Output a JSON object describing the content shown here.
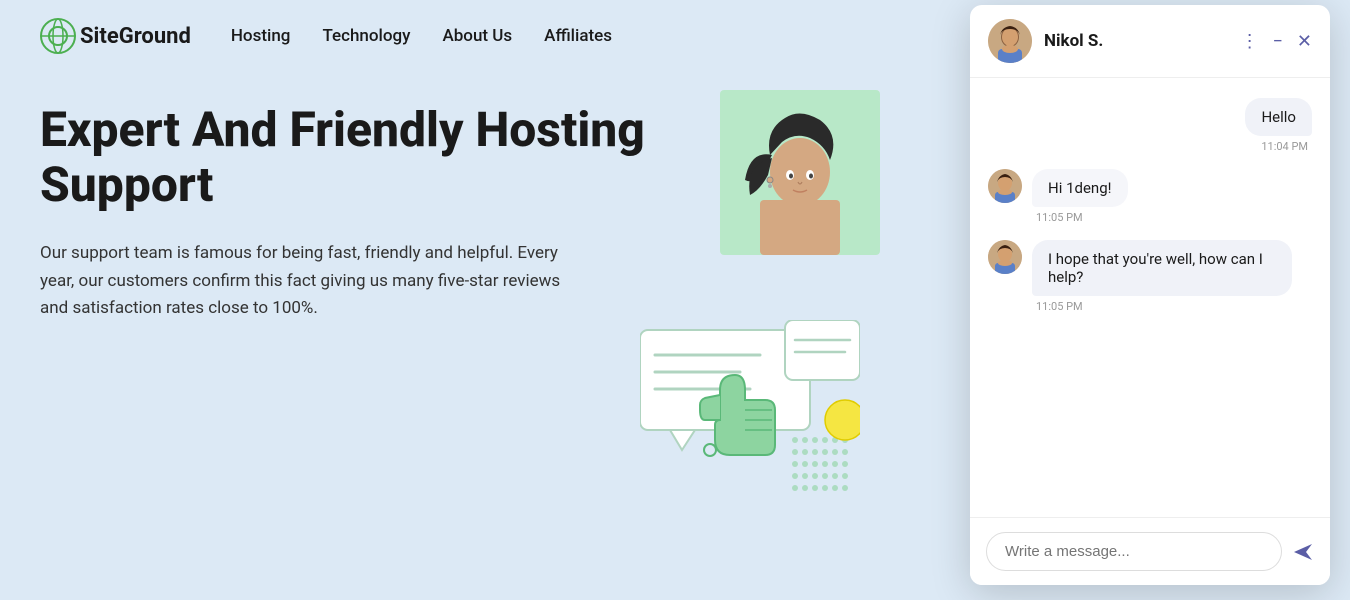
{
  "nav": {
    "logo_text": "SiteGround",
    "links": [
      {
        "label": "Hosting",
        "id": "hosting"
      },
      {
        "label": "Technology",
        "id": "technology"
      },
      {
        "label": "About Us",
        "id": "about-us"
      },
      {
        "label": "Affiliates",
        "id": "affiliates"
      }
    ]
  },
  "hero": {
    "heading": "Expert And Friendly Hosting Support",
    "body": "Our support team is famous for being fast, friendly and helpful. Every year, our customers confirm this fact giving us many five-star reviews and satisfaction rates close to 100%."
  },
  "chat": {
    "agent_name": "Nikol S.",
    "messages": [
      {
        "type": "right",
        "text": "Hello",
        "time": "11:04 PM"
      },
      {
        "type": "left",
        "text": "Hi 1deng!",
        "time": "11:05 PM"
      },
      {
        "type": "left",
        "text": "I hope that you're well, how can I help?",
        "time": "11:05 PM"
      }
    ],
    "input_placeholder": "Write a message...",
    "header_icons": {
      "more": "⋮",
      "minimize": "−",
      "close": "✕"
    },
    "send_icon": "➤"
  }
}
